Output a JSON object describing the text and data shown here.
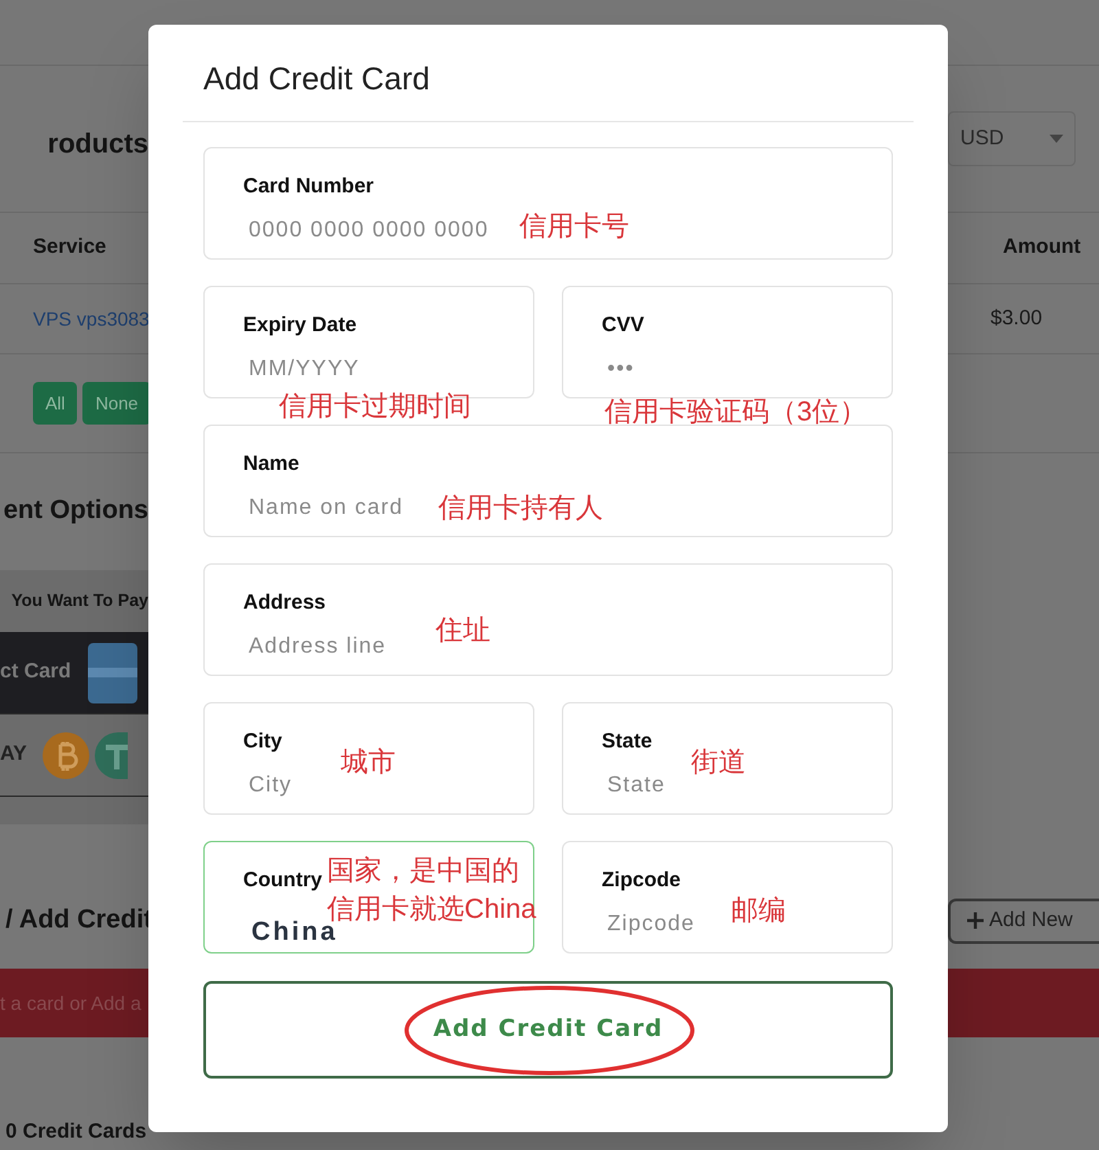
{
  "page": {
    "products_heading": "roducts",
    "currency": "USD",
    "table": {
      "columns": [
        "Service",
        "Amount"
      ],
      "rows": [
        {
          "service": "VPS vps3083",
          "amount": "$3.00"
        }
      ]
    },
    "select_buttons": [
      "All",
      "None"
    ],
    "payment_heading": "ent Options",
    "payment_prompt": "You Want To Pay",
    "payment_methods": [
      {
        "label": "ct Card",
        "kind": "card",
        "selected": true
      },
      {
        "label": "AY",
        "kind": "crypto",
        "selected": false
      }
    ],
    "cards_heading": "/ Add Credit",
    "add_button": "Add New",
    "alert": "t a card or Add a",
    "card_count": "0 Credit Cards"
  },
  "modal": {
    "title": "Add Credit Card",
    "fields": [
      {
        "label": "Card Number",
        "placeholder": "0000 0000 0000 0000",
        "kind": "text",
        "notes": [
          "信用卡号"
        ]
      },
      {
        "label": "Expiry Date",
        "placeholder": "MM/YYYY",
        "kind": "text",
        "notes": [
          "信用卡过期时间"
        ]
      },
      {
        "label": "CVV",
        "placeholder": "•••",
        "kind": "text",
        "notes": [
          "信用卡验证码（3位）"
        ]
      },
      {
        "label": "Name",
        "placeholder": "Name on card",
        "kind": "text",
        "notes": [
          "信用卡持有人"
        ]
      },
      {
        "label": "Address",
        "placeholder": "Address line",
        "kind": "text",
        "notes": [
          "住址"
        ]
      },
      {
        "label": "City",
        "placeholder": "City",
        "kind": "text",
        "notes": [
          "城市"
        ]
      },
      {
        "label": "State",
        "placeholder": "State",
        "kind": "text",
        "notes": [
          "街道"
        ]
      },
      {
        "label": "Country",
        "value": "China",
        "kind": "select",
        "focused": true,
        "notes": [
          "国家，是中国的",
          "信用卡就选China"
        ]
      },
      {
        "label": "Zipcode",
        "placeholder": "Zipcode",
        "kind": "text",
        "notes": [
          "邮编"
        ]
      }
    ],
    "submit": {
      "label": "Add Credit Card",
      "circled": true
    }
  }
}
